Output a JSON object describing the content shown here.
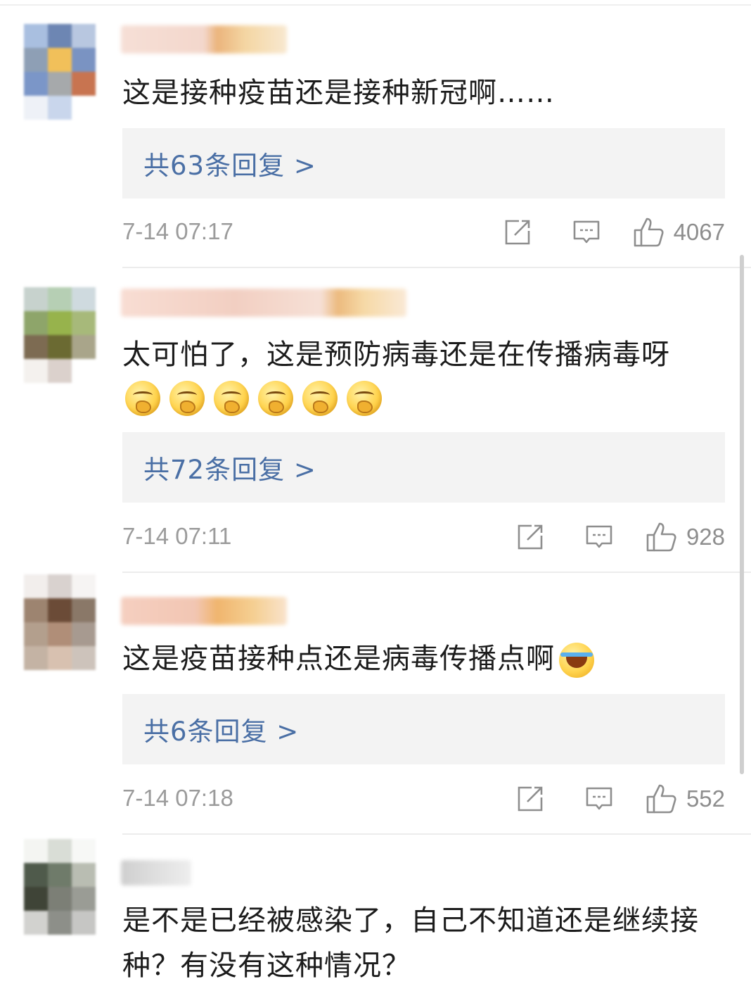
{
  "comments": [
    {
      "text": "这是接种疫苗还是接种新冠啊……",
      "replies": "共63条回复 >",
      "time": "7-14 07:17",
      "likes": "4067",
      "emojis": []
    },
    {
      "text": "太可怕了，这是预防病毒还是在传播病毒呀",
      "replies": "共72条回复 >",
      "time": "7-14 07:11",
      "likes": "928",
      "emojis": [
        "thinking-emoji",
        "thinking-emoji",
        "thinking-emoji",
        "thinking-emoji",
        "thinking-emoji",
        "thinking-emoji"
      ]
    },
    {
      "text": "这是疫苗接种点还是病毒传播点啊",
      "replies": "共6条回复 >",
      "time": "7-14 07:18",
      "likes": "552",
      "emojis": [
        "laugh-cry-emoji"
      ]
    },
    {
      "text": "是不是已经被感染了，自己不知道还是继续接种？有没有这种情况？"
    }
  ],
  "icons": {
    "repost": "share-icon",
    "comment": "comment-icon",
    "like": "thumbs-up-icon"
  },
  "colors": {
    "reply_link": "#4a6fa5",
    "reply_bg": "#f3f3f3",
    "meta_text": "#9b9b9b"
  }
}
